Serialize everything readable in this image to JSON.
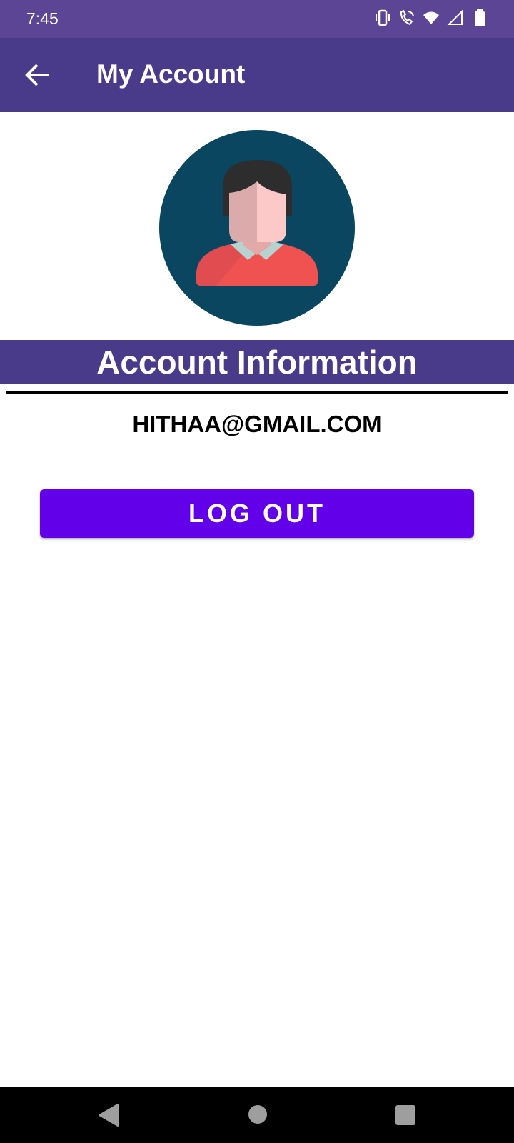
{
  "status_bar": {
    "time": "7:45",
    "icons": [
      "vibrate-icon",
      "wifi-calling-icon",
      "wifi-icon",
      "signal-icon",
      "battery-icon"
    ]
  },
  "app_bar": {
    "title": "My Account",
    "back_icon": "arrow-left-icon"
  },
  "avatar": {
    "icon": "user-avatar-icon",
    "colors": {
      "background": "#0a4660",
      "hair": "#2d2d2d",
      "face": "#fcc8c8",
      "shirt": "#f05252",
      "collar": "#b7d3cf"
    }
  },
  "account_section": {
    "heading": "Account Information",
    "email": "HITHAA@GMAIL.COM"
  },
  "actions": {
    "logout_label": "LOG OUT"
  },
  "nav_bar": {
    "icons": [
      "back-triangle-icon",
      "home-circle-icon",
      "recents-square-icon"
    ]
  },
  "colors": {
    "status_bar": "#5d4596",
    "primary": "#4a3b8a",
    "button": "#6200ea"
  }
}
